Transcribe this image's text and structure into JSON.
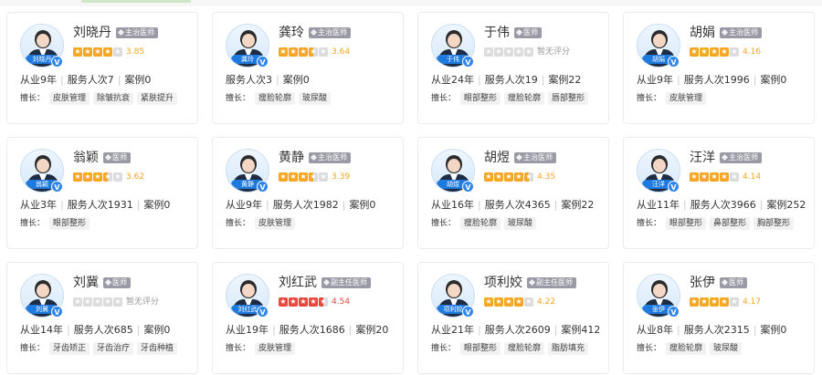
{
  "doctors": [
    {
      "name": "刘晓丹",
      "avatar_label": "刘晓丹",
      "title": "主治医师",
      "rating": 3.85,
      "score_text": "3.85",
      "stats": [
        "从业9年",
        "服务人次7",
        "案例0"
      ],
      "skills_label": "擅长：",
      "skills": [
        "皮肤管理",
        "除皱抗衰",
        "紧肤提升"
      ]
    },
    {
      "name": "龚玲",
      "avatar_label": "龚玲",
      "title": "主治医师",
      "rating": 3.64,
      "score_text": "3.64",
      "stats": [
        "服务人次3",
        "案例0"
      ],
      "skills_label": "擅长：",
      "skills": [
        "瘦脸轮廓",
        "玻尿酸"
      ]
    },
    {
      "name": "于伟",
      "avatar_label": "于伟",
      "title": "医师",
      "rating": 0,
      "score_text": "暂无评分",
      "stats": [
        "从业24年",
        "服务人次19",
        "案例22"
      ],
      "skills_label": "擅长：",
      "skills": [
        "眼部整形",
        "瘦脸轮廓",
        "唇部整形"
      ]
    },
    {
      "name": "胡娟",
      "avatar_label": "胡娟",
      "title": "主治医师",
      "rating": 4.16,
      "score_text": "4.16",
      "stats": [
        "从业9年",
        "服务人次1996",
        "案例0"
      ],
      "skills_label": "擅长：",
      "skills": [
        "皮肤管理"
      ]
    },
    {
      "name": "翁颖",
      "avatar_label": "翁颖",
      "title": "医师",
      "rating": 3.62,
      "score_text": "3.62",
      "stats": [
        "从业3年",
        "服务人次1931",
        "案例0"
      ],
      "skills_label": "擅长：",
      "skills": [
        "眼部整形"
      ]
    },
    {
      "name": "黄静",
      "avatar_label": "黄静",
      "title": "主治医师",
      "rating": 3.39,
      "score_text": "3.39",
      "stats": [
        "从业9年",
        "服务人次1982",
        "案例0"
      ],
      "skills_label": "擅长：",
      "skills": [
        "皮肤管理"
      ]
    },
    {
      "name": "胡煜",
      "avatar_label": "胡煜",
      "title": "主治医师",
      "rating": 4.35,
      "score_text": "4.35",
      "stats": [
        "从业16年",
        "服务人次4365",
        "案例22"
      ],
      "skills_label": "擅长：",
      "skills": [
        "瘦脸轮廓",
        "玻尿酸"
      ]
    },
    {
      "name": "汪洋",
      "avatar_label": "汪洋",
      "title": "主治医师",
      "rating": 4.14,
      "score_text": "4.14",
      "stats": [
        "从业11年",
        "服务人次3966",
        "案例252"
      ],
      "skills_label": "擅长：",
      "skills": [
        "眼部整形",
        "鼻部整形",
        "胸部整形"
      ]
    },
    {
      "name": "刘冀",
      "avatar_label": "刘冀",
      "title": "医师",
      "rating": 0,
      "score_text": "暂无评分",
      "stats": [
        "从业14年",
        "服务人次685",
        "案例0"
      ],
      "skills_label": "擅长：",
      "skills": [
        "牙齿矫正",
        "牙齿治疗",
        "牙齿种植"
      ]
    },
    {
      "name": "刘红武",
      "avatar_label": "刘红武",
      "title": "副主任医师",
      "rating": 4.54,
      "score_text": "4.54",
      "score_color": "red",
      "stats": [
        "从业19年",
        "服务人次1686",
        "案例20"
      ],
      "skills_label": "擅长：",
      "skills": [
        "皮肤管理"
      ]
    },
    {
      "name": "项利姣",
      "avatar_label": "项利姣",
      "title": "副主任医师",
      "rating": 4.22,
      "score_text": "4.22",
      "stats": [
        "从业21年",
        "服务人次2609",
        "案例412"
      ],
      "skills_label": "擅长：",
      "skills": [
        "眼部整形",
        "瘦脸轮廓",
        "脂肪填充"
      ]
    },
    {
      "name": "张伊",
      "avatar_label": "张伊",
      "title": "医师",
      "rating": 4.17,
      "score_text": "4.17",
      "stats": [
        "从业8年",
        "服务人次2315",
        "案例0"
      ],
      "skills_label": "擅长：",
      "skills": [
        "瘦脸轮廓",
        "玻尿酸"
      ]
    }
  ],
  "colors": {
    "star": "#f5a623",
    "star_red": "#e8473f",
    "badge": "#9a9aa6",
    "avatar_label_bg": "#1f7ae0"
  },
  "icons": {
    "verified": "verified-v-icon",
    "star": "star-icon",
    "title_diamond": "diamond-icon"
  },
  "verified_mark": "V"
}
